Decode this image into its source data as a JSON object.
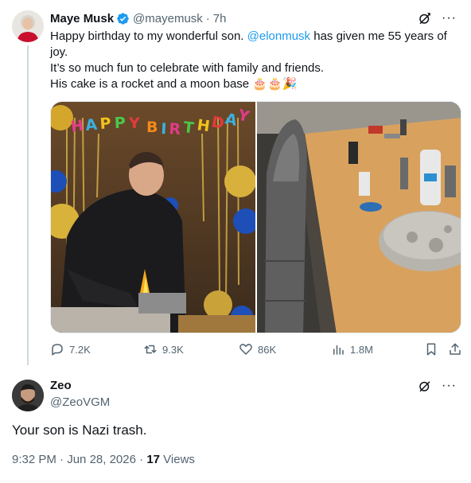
{
  "tweet": {
    "author_name": "Maye Musk",
    "author_handle": "@mayemusk",
    "time": "7h",
    "text_line1_pre": "Happy birthday to my wonderful son. ",
    "mention": "@elonmusk",
    "text_line1_post": " has given me 55 years of joy.",
    "text_line2": "It’s so much fun to celebrate with family and friends.",
    "text_line3": "His cake is a rocket and a moon base",
    "emojis": "🎂🎂🎉",
    "banner_text": "HAPPY BIRTHDAY",
    "stats": {
      "replies": "7.2K",
      "retweets": "9.3K",
      "likes": "86K",
      "views": "1.8M"
    }
  },
  "reply": {
    "author_name": "Zeo",
    "author_handle": "@ZeoVGM",
    "text": "Your son is Nazi trash.",
    "time": "9:32 PM",
    "date": "Jun 28, 2026",
    "views_count": "17",
    "views_label": "Views"
  },
  "icons": {
    "grok": "grok-icon",
    "more": "more-icon",
    "verified": "verified-badge-icon",
    "reply": "reply-icon",
    "retweet": "retweet-icon",
    "like": "heart-icon",
    "views": "views-chart-icon",
    "bookmark": "bookmark-icon",
    "share": "share-icon"
  },
  "colors": {
    "accent": "#1d9bf0",
    "text": "#0f1419",
    "muted": "#536471"
  }
}
